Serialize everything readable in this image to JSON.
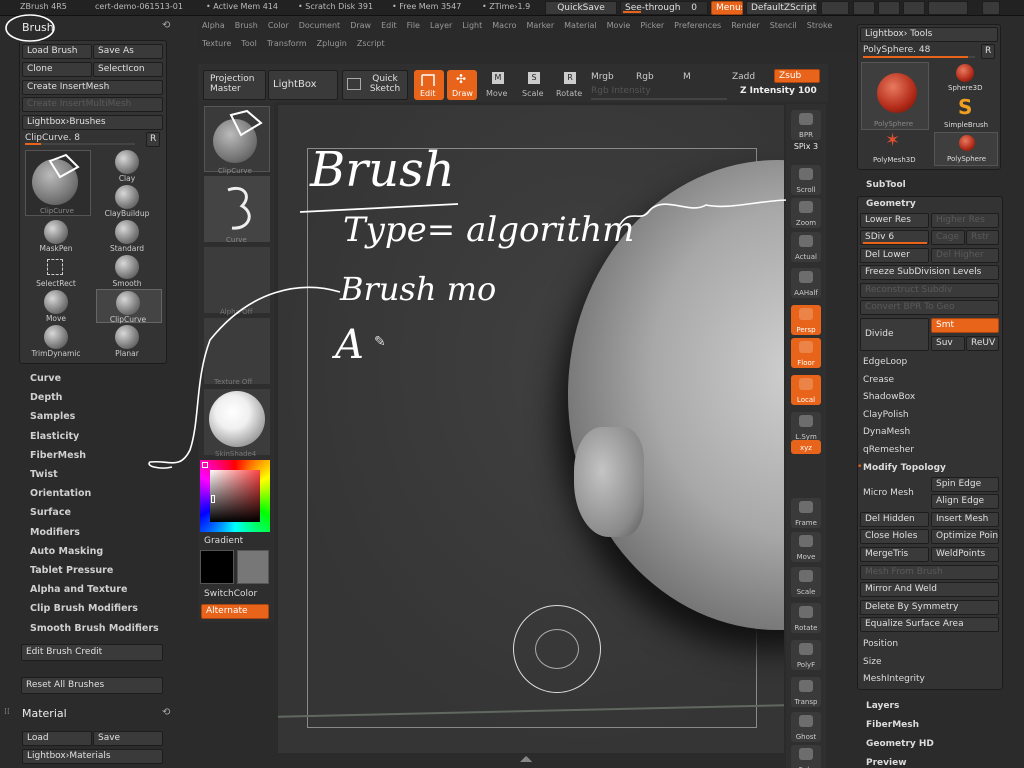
{
  "topbar": {
    "app": "ZBrush 4R5",
    "doc": "cert-demo-061513-01",
    "active_mem": "• Active Mem 414",
    "scratch": "• Scratch Disk 391",
    "free_mem": "• Free Mem 3547",
    "ztime": "• ZTime›1.9",
    "quicksave": "QuickSave",
    "seethrough": "See-through",
    "seethrough_val": "0",
    "menus": "Menus",
    "zscript": "DefaultZScript"
  },
  "mainmenu": {
    "row1": [
      "Alpha",
      "Brush",
      "Color",
      "Document",
      "Draw",
      "Edit",
      "File",
      "Layer",
      "Light",
      "Macro",
      "Marker",
      "Material",
      "Movie",
      "Picker",
      "Preferences",
      "Render",
      "Stencil",
      "Stroke"
    ],
    "row2": [
      "Texture",
      "Tool",
      "Transform",
      "Zplugin",
      "Zscript"
    ]
  },
  "brush_palette": {
    "title": "Brush",
    "load": "Load Brush",
    "save": "Save As",
    "clone": "Clone",
    "select_icon": "SelectIcon",
    "create_insert": "Create InsertMesh",
    "create_insert_multi": "Create InsertMultiMesh",
    "lightbox_brushes": "Lightbox›Brushes",
    "current": "ClipCurve. 8",
    "r": "R",
    "brushes": [
      {
        "name": "ClipCurve"
      },
      {
        "name": "Clay"
      },
      {
        "name": "ClayBuildup"
      },
      {
        "name": "MaskPen"
      },
      {
        "name": "Standard"
      },
      {
        "name": "SelectRect"
      },
      {
        "name": "Smooth"
      },
      {
        "name": "Move"
      },
      {
        "name": "ClipCurve"
      },
      {
        "name": "TrimDynamic"
      },
      {
        "name": "Planar"
      }
    ],
    "submenus": [
      "Curve",
      "Depth",
      "Samples",
      "Elasticity",
      "FiberMesh",
      "Twist",
      "Orientation",
      "Surface",
      "Modifiers",
      "Auto Masking",
      "Tablet Pressure",
      "Alpha and Texture",
      "Clip Brush Modifiers",
      "Smooth Brush Modifiers"
    ],
    "edit_credit": "Edit Brush Credit",
    "reset_all": "Reset All Brushes"
  },
  "material_palette": {
    "title": "Material",
    "load": "Load",
    "save": "Save",
    "lightbox": "Lightbox›Materials"
  },
  "shelf": {
    "projection_master": "Projection Master",
    "lightbox": "LightBox",
    "quick_sketch": "Quick Sketch",
    "edit": "Edit",
    "draw": "Draw",
    "move": "Move",
    "scale": "Scale",
    "rotate": "Rotate",
    "mrgb": "Mrgb",
    "rgb": "Rgb",
    "m": "M",
    "zadd": "Zadd",
    "zsub": "Zsub",
    "rgb_intensity": "Rgb Intensity",
    "z_intensity": "Z Intensity 100"
  },
  "left_tray": {
    "brush_label": "ClipCurve",
    "stroke_label": "Curve",
    "alpha_label": "Alpha Off",
    "texture_label": "Texture Off",
    "material_label": "SkinShade4",
    "gradient": "Gradient",
    "switch_color": "SwitchColor",
    "alternate": "Alternate"
  },
  "right_toolbar": [
    "BPR",
    "SPix 3",
    "Scroll",
    "Zoom",
    "Actual",
    "AAHalf",
    "Persp",
    "Floor",
    "Local",
    "L.Sym",
    "xyz",
    "Frame",
    "Move",
    "Scale",
    "Rotate",
    "PolyF",
    "Transp",
    "Ghost",
    "Solo"
  ],
  "tool_palette": {
    "lightbox_tools": "Lightbox› Tools",
    "current_tool": "PolySphere. 48",
    "r": "R",
    "tools": [
      "PolySphere",
      "Sphere3D",
      "SimpleBrush",
      "PolyMesh3D",
      "PolySphere"
    ],
    "subtool": "SubTool",
    "geometry": "Geometry",
    "lower_res": "Lower Res",
    "higher_res": "Higher Res",
    "sdiv": "SDiv 6",
    "cage": "Cage",
    "rstr": "Rstr",
    "del_lower": "Del Lower",
    "del_higher": "Del Higher",
    "freeze": "Freeze SubDivision Levels",
    "reconstruct": "Reconstruct Subdiv",
    "convert_bpr": "Convert BPR To Geo",
    "divide": "Divide",
    "smt": "Smt",
    "suv": "Suv",
    "reuv": "ReUV",
    "edgeloop": "EdgeLoop",
    "crease": "Crease",
    "shadowbox": "ShadowBox",
    "claypolish": "ClayPolish",
    "dynamesh": "DynaMesh",
    "qremesher": "qRemesher",
    "modify_topology": "Modify Topology",
    "micro_mesh": "Micro Mesh",
    "spin_edge": "Spin Edge",
    "align_edge": "Align Edge",
    "del_hidden": "Del Hidden",
    "insert_mesh": "Insert Mesh",
    "close_holes": "Close Holes",
    "optimize": "Optimize Poin",
    "mergetris": "MergeTris",
    "weldpoints": "WeldPoints",
    "mesh_from_brush": "Mesh From Brush",
    "mirror_weld": "Mirror And Weld",
    "delete_symmetry": "Delete By Symmetry",
    "equalize": "Equalize Surface Area",
    "position": "Position",
    "size": "Size",
    "meshintegrity": "MeshIntegrity",
    "layers": "Layers",
    "fibermesh": "FiberMesh",
    "geometry_hd": "Geometry HD",
    "preview": "Preview"
  },
  "annotation": {
    "line1": "Brush",
    "line2": "Type= algorithm",
    "line3": "Brush mo",
    "line4": "A"
  },
  "colors": {
    "accent": "#e8641a",
    "panel": "#333333",
    "canvas": "#3a3a3a"
  }
}
